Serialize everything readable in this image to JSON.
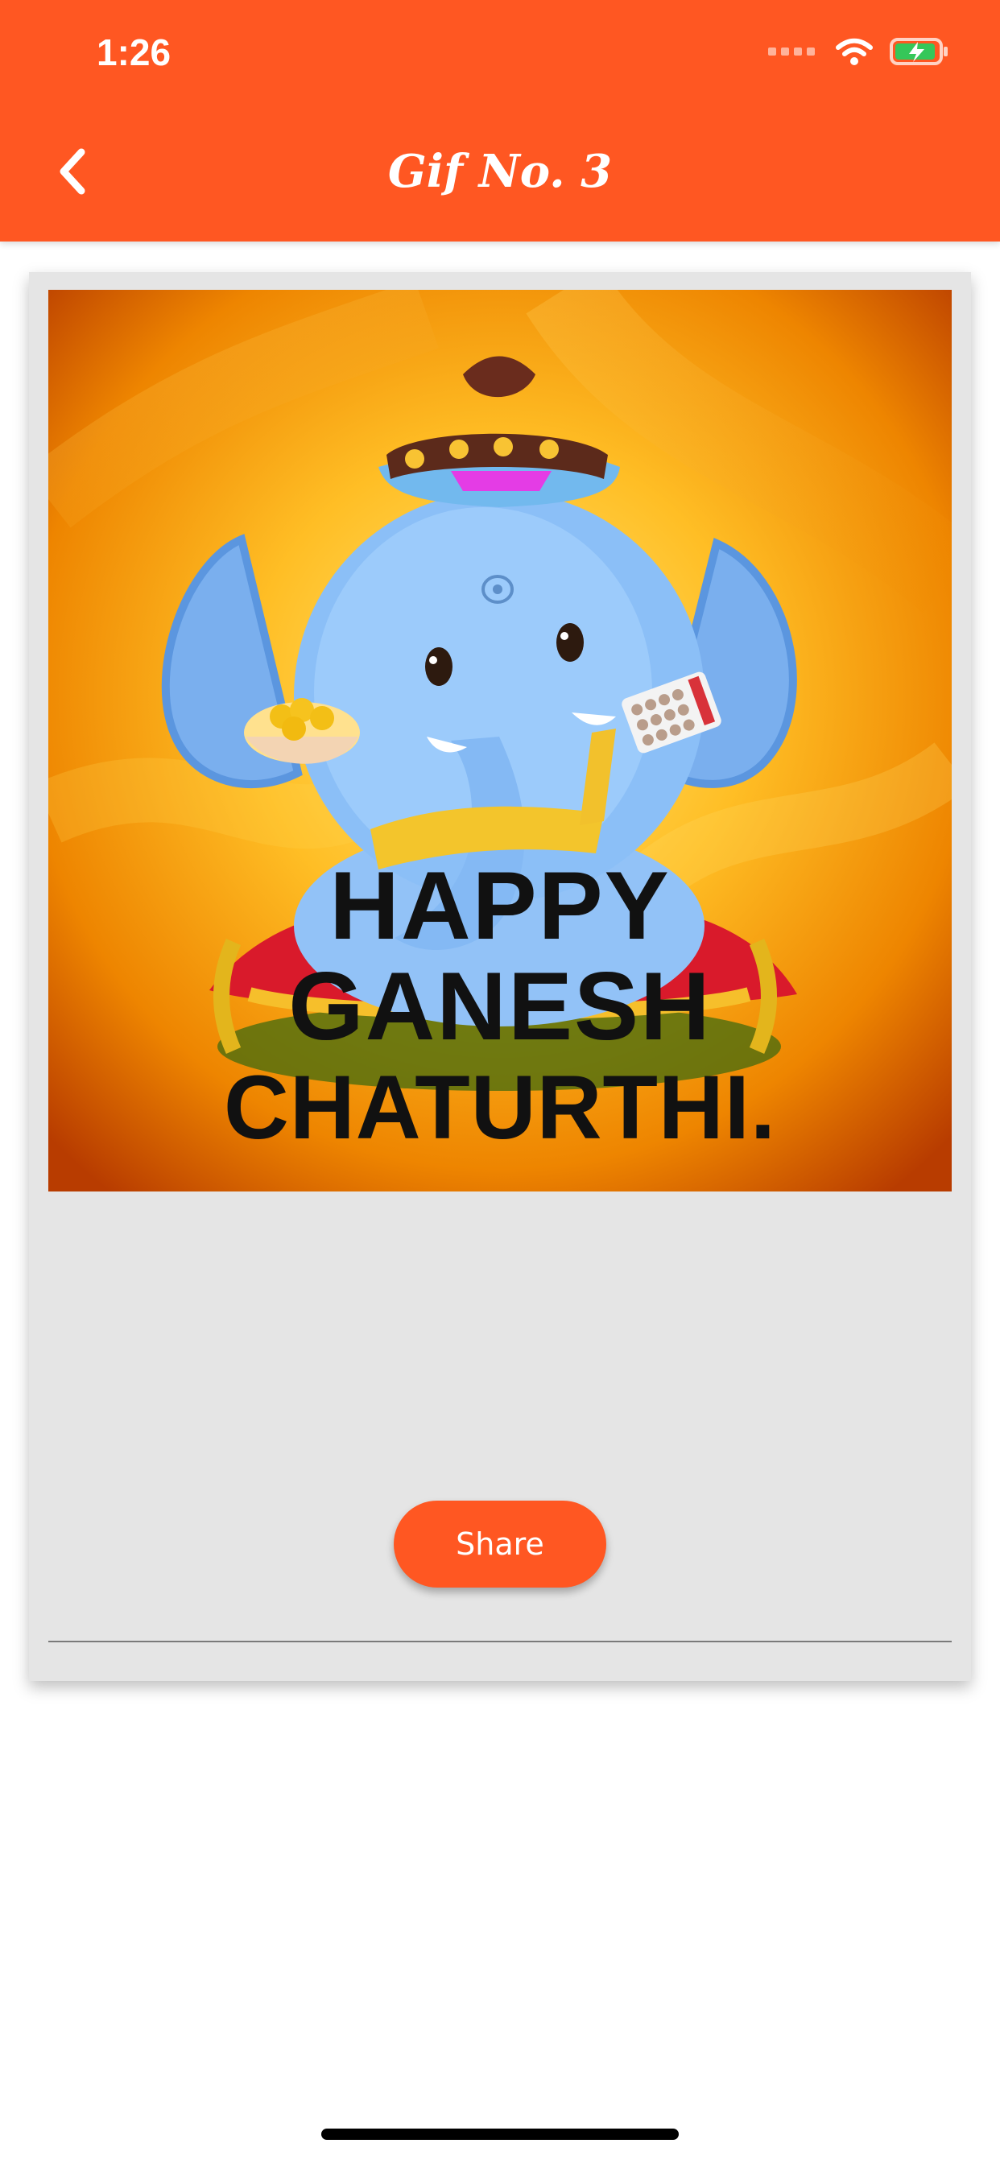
{
  "status": {
    "time": "1:26",
    "icons": [
      "signal-dots-icon",
      "wifi-icon",
      "battery-charging-icon"
    ]
  },
  "header": {
    "title": "Gif No. 3",
    "back_icon": "chevron-left-icon"
  },
  "gif": {
    "greeting_lines": [
      "HAPPY",
      "GANESH",
      "CHATURTHI."
    ]
  },
  "actions": {
    "share_label": "Share"
  },
  "colors": {
    "primary": "#ff5722",
    "card_background": "#e5e5e5",
    "page_background": "#ffffff"
  }
}
